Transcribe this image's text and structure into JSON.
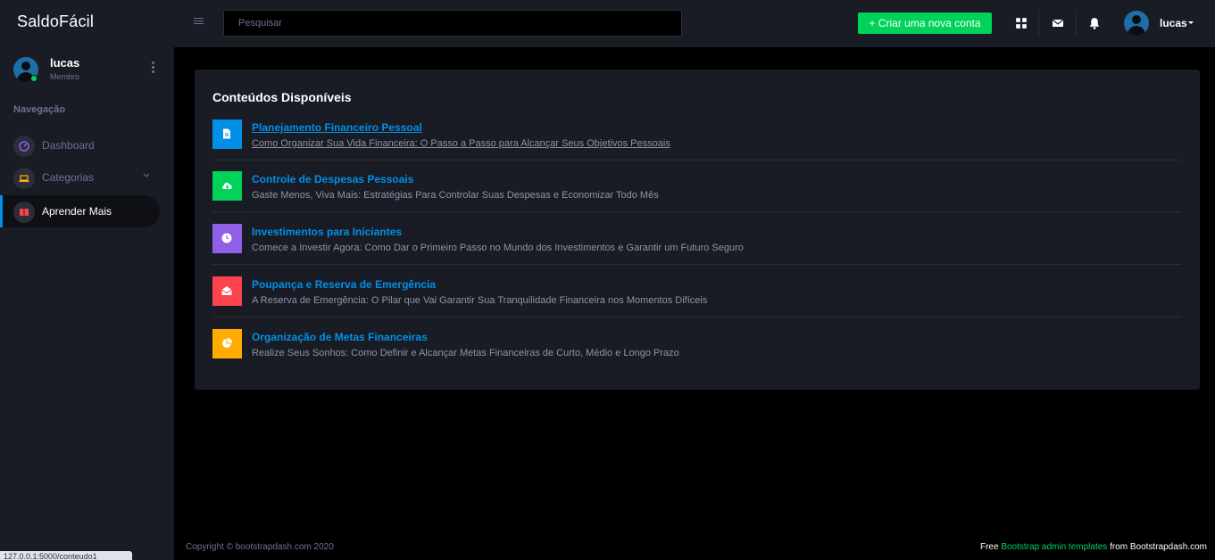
{
  "brand": "SaldoFácil",
  "profile": {
    "name": "lucas",
    "role": "Membro"
  },
  "sidebar": {
    "caption": "Navegação",
    "items": [
      {
        "label": "Dashboard",
        "icon": "speedometer-icon",
        "icon_color": "#8f5fe8"
      },
      {
        "label": "Categorias",
        "icon": "laptop-icon",
        "icon_color": "#ffab00"
      },
      {
        "label": "Aprender Mais",
        "icon": "book-icon",
        "icon_color": "#fc424a",
        "active": true
      }
    ]
  },
  "topbar": {
    "search_placeholder": "Pesquisar",
    "new_account_label": "+ Criar uma nova conta",
    "user_name": "lucas"
  },
  "content": {
    "title": "Conteúdos Disponíveis",
    "items": [
      {
        "title": "Planejamento Financeiro Pessoal",
        "subtitle": "Como Organizar Sua Vida Financeira: O Passo a Passo para Alcançar Seus Objetivos Pessoais",
        "icon": "file-icon",
        "color": "#0090e7"
      },
      {
        "title": "Controle de Despesas Pessoais",
        "subtitle": "Gaste Menos, Viva Mais: Estratégias Para Controlar Suas Despesas e Economizar Todo Mês",
        "icon": "cloud-download-icon",
        "color": "#00d25b"
      },
      {
        "title": "Investimentos para Iniciantes",
        "subtitle": "Comece a Investir Agora: Como Dar o Primeiro Passo no Mundo dos Investimentos e Garantir um Futuro Seguro",
        "icon": "clock-icon",
        "color": "#8f5fe8"
      },
      {
        "title": "Poupança e Reserva de Emergência",
        "subtitle": "A Reserva de Emergência: O Pilar que Vai Garantir Sua Tranquilidade Financeira nos Momentos Difíceis",
        "icon": "envelope-open-icon",
        "color": "#fc424a"
      },
      {
        "title": "Organização de Metas Financeiras",
        "subtitle": "Realize Seus Sonhos: Como Definir e Alcançar Metas Financeiras de Curto, Médio e Longo Prazo",
        "icon": "pie-chart-icon",
        "color": "#ffab00"
      }
    ]
  },
  "footer": {
    "copyright": "Copyright © bootstrapdash.com 2020",
    "free": "Free",
    "link": "Bootstrap admin templates",
    "from": "from Bootstrapdash.com"
  },
  "status_url": "127.0.0.1:5000/conteudo1"
}
